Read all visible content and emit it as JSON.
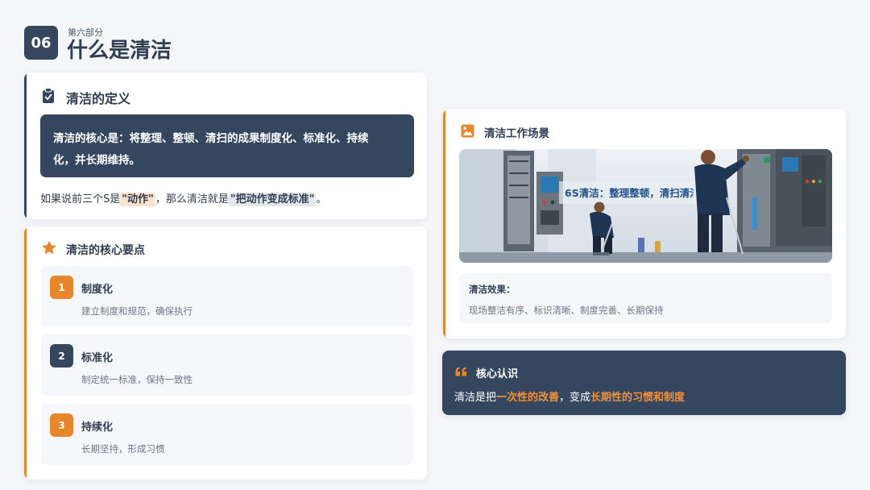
{
  "header": {
    "section_number": "06",
    "section_label": "第六部分",
    "title": "什么是清洁"
  },
  "definition": {
    "title": "清洁的定义",
    "core_line1": "清洁的核心是：将整理、整顿、清扫的成果制度化、标准化、持续",
    "core_line2": "化，并长期维持。",
    "note_prefix": "如果说前三个S是",
    "note_highlight1": "\"动作\"",
    "note_middle": "，那么清洁就是",
    "note_highlight2": "\"把动作变成标准\"",
    "note_suffix": "。"
  },
  "key_points": {
    "title": "清洁的核心要点",
    "items": [
      {
        "number": "1",
        "title": "制度化",
        "desc": "建立制度和规范，确保执行"
      },
      {
        "number": "2",
        "title": "标准化",
        "desc": "制定统一标准，保持一致性"
      },
      {
        "number": "3",
        "title": "持续化",
        "desc": "长期坚持，形成习惯"
      }
    ]
  },
  "scene": {
    "title": "清洁工作场景",
    "banner_text": "6S清洁：整理整顿，清扫清洁",
    "effect_title": "清洁效果：",
    "effect_desc": "现场整洁有序、标识清晰、制度完善、长期保持"
  },
  "insight": {
    "title": "核心认识",
    "text_prefix": "清洁是把",
    "highlight1": "一次性的改善",
    "text_middle": "，变成",
    "highlight2": "长期性的习惯和制度"
  },
  "colors": {
    "primary_dark": "#34475e",
    "accent_orange": "#e8862a",
    "background": "#f4f6f9"
  },
  "icons": [
    "clipboard-check-icon",
    "star-icon",
    "image-icon",
    "quote-icon"
  ]
}
